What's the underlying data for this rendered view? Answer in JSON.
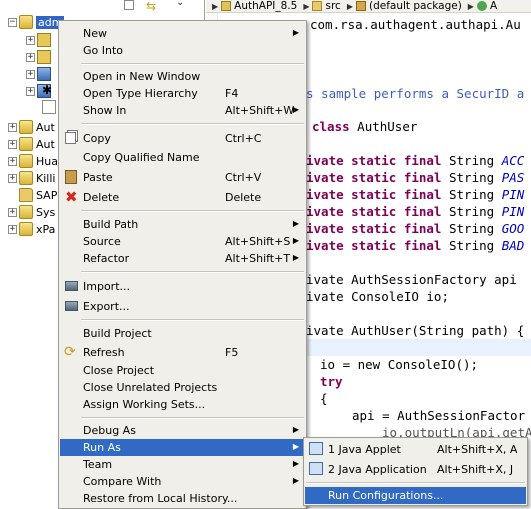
{
  "tree": {
    "items": [
      {
        "label": "adm",
        "expander": "−",
        "icon": "project-icon",
        "selected": true
      },
      {
        "label": "",
        "expander": "+",
        "icon": "package-icon"
      },
      {
        "label": "",
        "expander": "+",
        "icon": "package-icon"
      },
      {
        "label": "",
        "expander": "+",
        "icon": "library-icon"
      },
      {
        "label": "",
        "expander": "+",
        "icon": "library-icon"
      },
      {
        "label": "",
        "expander": "",
        "icon": "bug-icon"
      },
      {
        "label": "",
        "expander": "",
        "icon": "file-icon"
      },
      {
        "label": "Aut",
        "expander": "+",
        "icon": "project-icon"
      },
      {
        "label": "Aut",
        "expander": "+",
        "icon": "project-icon"
      },
      {
        "label": "Hua",
        "expander": "+",
        "icon": "project-icon"
      },
      {
        "label": "Killi",
        "expander": "+",
        "icon": "project-icon"
      },
      {
        "label": "SAP",
        "expander": "",
        "icon": "folder-icon"
      },
      {
        "label": "Sys",
        "expander": "+",
        "icon": "project-icon"
      },
      {
        "label": "xPa",
        "expander": "+",
        "icon": "project-icon"
      }
    ]
  },
  "breadcrumb": {
    "project": "AuthAPI_8.5",
    "folder": "src",
    "package": "(default package)",
    "extra": "A"
  },
  "code": {
    "line_package": "com.rsa.authagent.authapi.Au",
    "line_comment": "s sample performs a SecurID a",
    "line_class_kw": "class",
    "line_class_name": " AuthUser",
    "field_prefix": "ivate static final",
    "field_type": "String",
    "fields": [
      "ACC",
      "PAS",
      "PIN",
      "PIN",
      "GOO",
      "BAD"
    ],
    "line_factory_prefix": "ivate AuthSessionFactory api",
    "line_console_prefix": "ivate ConsoleIO io;",
    "line_ctor_prefix": "ivate AuthUser(String path) {",
    "line_io": "io = new ConsoleIO();",
    "line_try": "try",
    "line_brace": "{",
    "line_api": "api = AuthSessionFactor",
    "line_output": "io.outputLn(api.getA"
  },
  "menu": {
    "new": "New",
    "go_into": "Go Into",
    "open_new_window": "Open in New Window",
    "open_type_hierarchy": "Open Type Hierarchy",
    "open_type_hierarchy_acc": "F4",
    "show_in": "Show In",
    "show_in_acc": "Alt+Shift+W",
    "copy": "Copy",
    "copy_acc": "Ctrl+C",
    "copy_qualified": "Copy Qualified Name",
    "paste": "Paste",
    "paste_acc": "Ctrl+V",
    "delete": "Delete",
    "delete_acc": "Delete",
    "build_path": "Build Path",
    "source": "Source",
    "source_acc": "Alt+Shift+S",
    "refactor": "Refactor",
    "refactor_acc": "Alt+Shift+T",
    "import": "Import...",
    "export": "Export...",
    "build_project": "Build Project",
    "refresh": "Refresh",
    "refresh_acc": "F5",
    "close_project": "Close Project",
    "close_unrelated": "Close Unrelated Projects",
    "assign_working_sets": "Assign Working Sets...",
    "debug_as": "Debug As",
    "run_as": "Run As",
    "team": "Team",
    "compare_with": "Compare With",
    "restore_history": "Restore from Local History..."
  },
  "submenu": {
    "java_applet": "1 Java Applet",
    "java_applet_acc": "Alt+Shift+X, A",
    "java_application": "2 Java Application",
    "java_application_acc": "Alt+Shift+X, J",
    "run_configurations": "Run Configurations..."
  },
  "colors": {
    "menu_bg": "#f0efe9",
    "highlight": "#316ac5",
    "keyword": "#7f0055",
    "comment": "#3f5fbf",
    "field": "#0000c0"
  }
}
